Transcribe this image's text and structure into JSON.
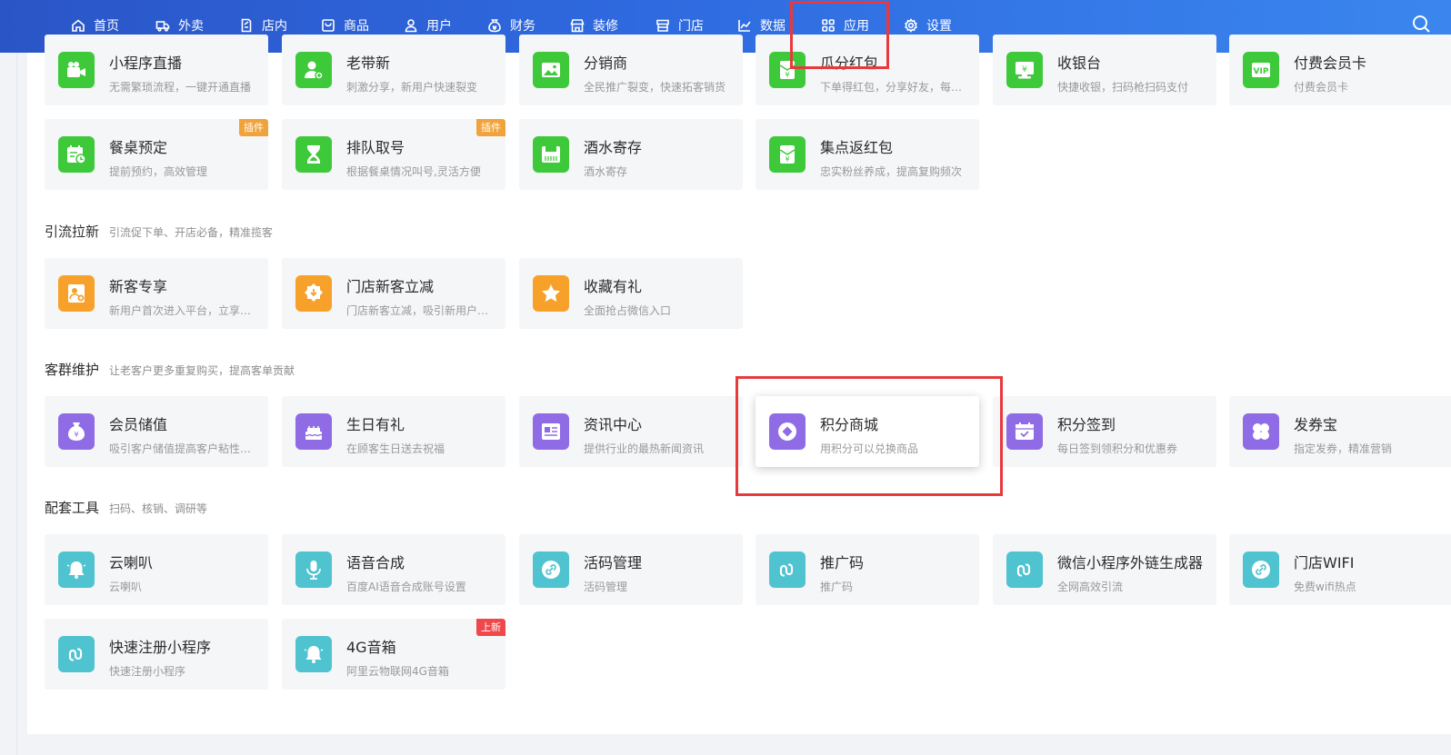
{
  "nav": {
    "items": [
      {
        "label": "首页",
        "icon": "home-icon"
      },
      {
        "label": "外卖",
        "icon": "delivery-icon"
      },
      {
        "label": "店内",
        "icon": "store-order-icon"
      },
      {
        "label": "商品",
        "icon": "goods-icon"
      },
      {
        "label": "用户",
        "icon": "user-icon"
      },
      {
        "label": "财务",
        "icon": "money-icon"
      },
      {
        "label": "装修",
        "icon": "decorate-icon"
      },
      {
        "label": "门店",
        "icon": "shop-icon"
      },
      {
        "label": "数据",
        "icon": "chart-icon"
      },
      {
        "label": "应用",
        "icon": "apps-icon"
      },
      {
        "label": "设置",
        "icon": "gear-icon"
      }
    ],
    "active": "应用",
    "search_icon": "search-icon"
  },
  "sections": [
    {
      "title": "引流拉新",
      "desc": "引流促下单、开店必备，精准揽客"
    },
    {
      "title": "客群维护",
      "desc": "让老客户更多重复购买，提高客单贡献"
    },
    {
      "title": "配套工具",
      "desc": "扫码、核销、调研等"
    }
  ],
  "cards": {
    "row1": [
      {
        "title": "小程序直播",
        "desc": "无需繁琐流程，一键开通直播",
        "icon": "video-camera-icon",
        "color": "#3ec93a"
      },
      {
        "title": "老带新",
        "desc": "刺激分享，新用户快速裂变",
        "icon": "add-user-icon",
        "color": "#3ec93a"
      },
      {
        "title": "分销商",
        "desc": "全民推广裂变，快速拓客销货",
        "icon": "image-icon",
        "color": "#3ec93a"
      },
      {
        "title": "瓜分红包",
        "desc": "下单得红包，分享好友，每人瓜分",
        "icon": "red-packet-icon",
        "color": "#3ec93a"
      },
      {
        "title": "收银台",
        "desc": "快捷收银，扫码枪扫码支付",
        "icon": "cashier-icon",
        "color": "#3ec93a"
      },
      {
        "title": "付费会员卡",
        "desc": "付费会员卡",
        "icon": "vip-card-icon",
        "color": "#3ec93a"
      }
    ],
    "row2": [
      {
        "title": "餐桌预定",
        "desc": "提前预约，高效管理",
        "icon": "calendar-clock-icon",
        "color": "#3ec93a",
        "tag": "插件"
      },
      {
        "title": "排队取号",
        "desc": "根据餐桌情况叫号,灵活方便",
        "icon": "hourglass-icon",
        "color": "#3ec93a",
        "tag": "插件"
      },
      {
        "title": "酒水寄存",
        "desc": "酒水寄存",
        "icon": "storage-icon",
        "color": "#3ec93a"
      },
      {
        "title": "集点返红包",
        "desc": "忠实粉丝养成，提高复购频次",
        "icon": "red-packet-icon",
        "color": "#3ec93a"
      }
    ],
    "acquire": [
      {
        "title": "新客专享",
        "desc": "新用户首次进入平台，立享好礼",
        "icon": "new-user-icon",
        "color": "#f7a12a"
      },
      {
        "title": "门店新客立减",
        "desc": "门店新客立减，吸引新用户下单",
        "icon": "discount-badge-icon",
        "color": "#f7a12a"
      },
      {
        "title": "收藏有礼",
        "desc": "全面抢占微信入口",
        "icon": "star-icon",
        "color": "#f7a12a"
      }
    ],
    "retain": [
      {
        "title": "会员储值",
        "desc": "吸引客户储值提高客户粘性和复购",
        "icon": "money-bag-icon",
        "color": "#8f6be6"
      },
      {
        "title": "生日有礼",
        "desc": "在顾客生日送去祝福",
        "icon": "cake-icon",
        "color": "#8f6be6"
      },
      {
        "title": "资讯中心",
        "desc": "提供行业的最热新闻资讯",
        "icon": "news-icon",
        "color": "#8f6be6"
      },
      {
        "title": "积分商城",
        "desc": "用积分可以兑换商品",
        "icon": "points-diamond-icon",
        "color": "#8f6be6"
      },
      {
        "title": "积分签到",
        "desc": "每日签到领积分和优惠券",
        "icon": "calendar-check-icon",
        "color": "#8f6be6"
      },
      {
        "title": "发券宝",
        "desc": "指定发券，精准营销",
        "icon": "clover-icon",
        "color": "#8f6be6"
      }
    ],
    "tools1": [
      {
        "title": "云喇叭",
        "desc": "云喇叭",
        "icon": "bell-icon",
        "color": "#4fc3cf"
      },
      {
        "title": "语音合成",
        "desc": "百度AI语音合成账号设置",
        "icon": "microphone-icon",
        "color": "#4fc3cf"
      },
      {
        "title": "活码管理",
        "desc": "活码管理",
        "icon": "link-icon",
        "color": "#4fc3cf"
      },
      {
        "title": "推广码",
        "desc": "推广码",
        "icon": "mini-program-icon",
        "color": "#4fc3cf"
      },
      {
        "title": "微信小程序外链生成器",
        "desc": "全网高效引流",
        "icon": "mini-program-icon",
        "color": "#4fc3cf"
      },
      {
        "title": "门店WIFI",
        "desc": "免费wifi热点",
        "icon": "link-icon",
        "color": "#4fc3cf"
      }
    ],
    "tools2": [
      {
        "title": "快速注册小程序",
        "desc": "快速注册小程序",
        "icon": "mini-program-icon",
        "color": "#4fc3cf"
      },
      {
        "title": "4G音箱",
        "desc": "阿里云物联网4G音箱",
        "icon": "bell-icon",
        "color": "#4fc3cf",
        "tag": "上新"
      }
    ]
  }
}
